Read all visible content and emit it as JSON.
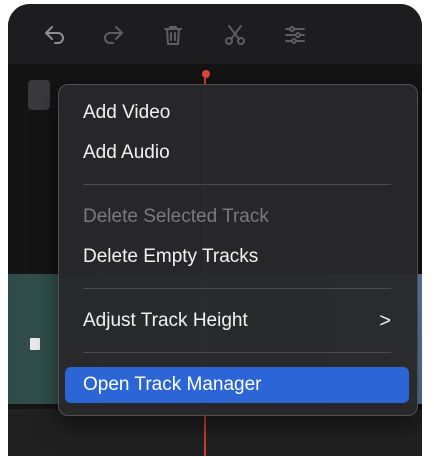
{
  "toolbar": {
    "icons": [
      "undo-icon",
      "redo-icon",
      "trash-icon",
      "scissors-icon",
      "adjust-icon"
    ]
  },
  "context_menu": {
    "items": [
      {
        "label": "Add Video",
        "enabled": true
      },
      {
        "label": "Add Audio",
        "enabled": true
      },
      {
        "label": "Delete Selected Track",
        "enabled": false
      },
      {
        "label": "Delete Empty Tracks",
        "enabled": true
      },
      {
        "label": "Adjust Track Height",
        "enabled": true,
        "submenu": true,
        "submenu_indicator": ">"
      },
      {
        "label": "Open Track Manager",
        "enabled": true,
        "highlighted": true
      }
    ]
  },
  "colors": {
    "highlight": "#2c66d6",
    "playhead": "#d23b2f",
    "menu_background": "#28282a"
  }
}
